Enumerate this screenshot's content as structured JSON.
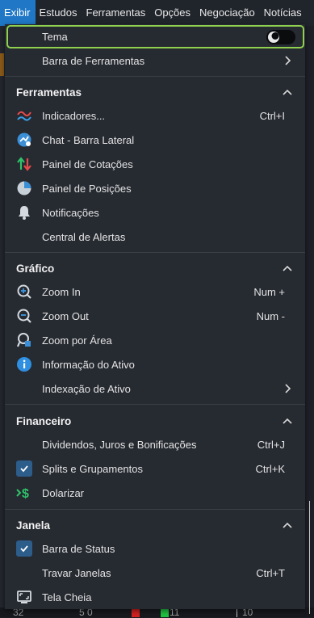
{
  "menubar": {
    "items": [
      "Exibir",
      "Estudos",
      "Ferramentas",
      "Opções",
      "Negociação",
      "Notícias"
    ]
  },
  "background": {
    "bottom_numbers": [
      "32",
      "5 0",
      "11",
      "10"
    ]
  },
  "dropdown": {
    "tema": {
      "label": "Tema",
      "icon": "theme-moon-icon",
      "toggle_on": false
    },
    "barra_ferramentas": {
      "label": "Barra de Ferramentas"
    },
    "sections": {
      "ferramentas": {
        "title": "Ferramentas",
        "items": [
          {
            "label": "Indicadores...",
            "shortcut": "Ctrl+I",
            "icon": "indicators-icon"
          },
          {
            "label": "Chat - Barra Lateral",
            "shortcut": "",
            "icon": "chat-icon"
          },
          {
            "label": "Painel de Cotações",
            "shortcut": "",
            "icon": "quotes-icon"
          },
          {
            "label": "Painel de Posições",
            "shortcut": "",
            "icon": "positions-pie-icon"
          },
          {
            "label": "Notificações",
            "shortcut": "",
            "icon": "bell-icon"
          },
          {
            "label": "Central de Alertas",
            "shortcut": "",
            "icon": ""
          }
        ]
      },
      "grafico": {
        "title": "Gráfico",
        "items": [
          {
            "label": "Zoom In",
            "shortcut": "Num +",
            "icon": "zoom-in-icon"
          },
          {
            "label": "Zoom Out",
            "shortcut": "Num -",
            "icon": "zoom-out-icon"
          },
          {
            "label": "Zoom por Área",
            "shortcut": "",
            "icon": "zoom-area-icon"
          },
          {
            "label": "Informação do Ativo",
            "shortcut": "",
            "icon": "info-icon"
          },
          {
            "label": "Indexação de Ativo",
            "shortcut": "",
            "icon": ""
          }
        ]
      },
      "financeiro": {
        "title": "Financeiro",
        "items": [
          {
            "label": "Dividendos, Juros e Bonificações",
            "shortcut": "Ctrl+J",
            "icon": ""
          },
          {
            "label": "Splits e Grupamentos",
            "shortcut": "Ctrl+K",
            "icon": "checkmark-icon",
            "checked": true
          },
          {
            "label": "Dolarizar",
            "shortcut": "",
            "icon": "dollar-icon"
          }
        ]
      },
      "janela": {
        "title": "Janela",
        "items": [
          {
            "label": "Barra de Status",
            "shortcut": "",
            "icon": "checkmark-icon",
            "checked": true
          },
          {
            "label": "Travar Janelas",
            "shortcut": "Ctrl+T",
            "icon": ""
          },
          {
            "label": "Tela Cheia",
            "shortcut": "",
            "icon": "fullscreen-icon"
          }
        ]
      }
    }
  },
  "colors": {
    "accent": "#1f77c6",
    "highlight_border": "#8fd14f",
    "menu_bg": "#262a31"
  }
}
